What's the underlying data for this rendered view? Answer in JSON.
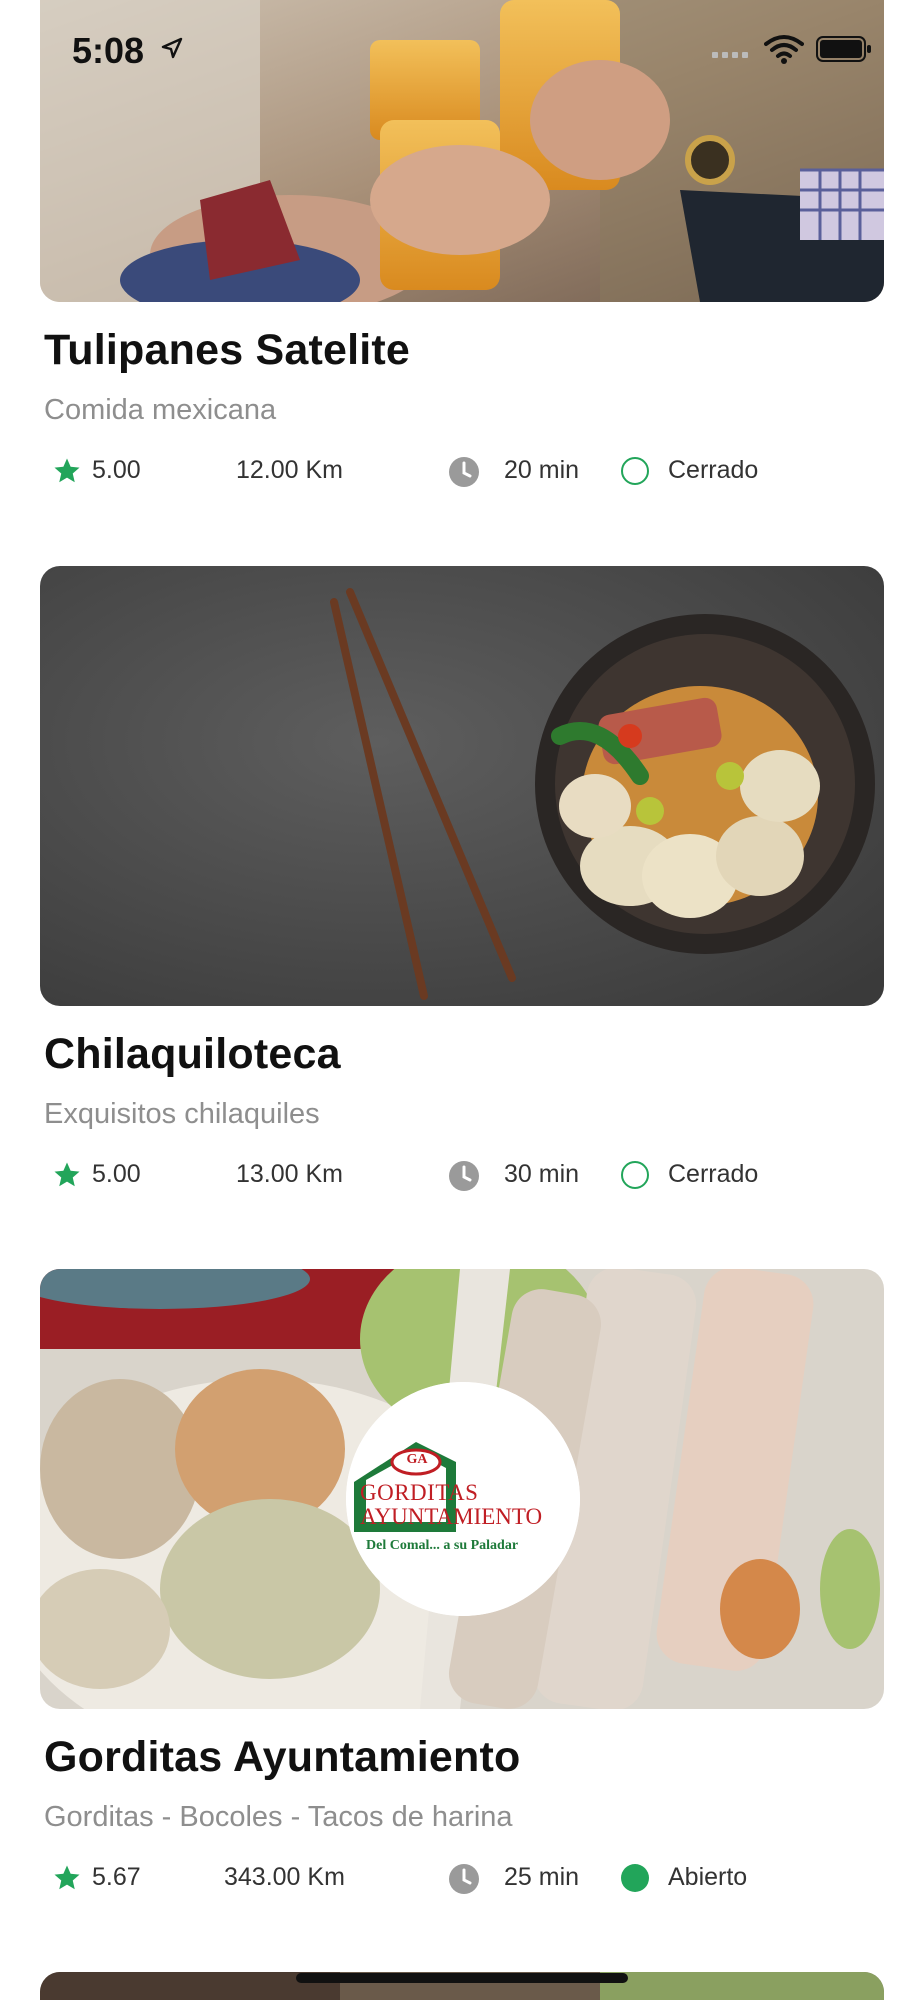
{
  "status_bar": {
    "time": "5:08"
  },
  "restaurants": [
    {
      "name": "Tulipanes Satelite",
      "subtitle": "Comida mexicana",
      "rating": "5.00",
      "distance": "12.00 Km",
      "time": "20 min",
      "status": "Cerrado",
      "status_open": false,
      "image_icon": "beer-toast-photo"
    },
    {
      "name": "Chilaquiloteca",
      "subtitle": "Exquisitos chilaquiles",
      "rating": "5.00",
      "distance": "13.00 Km",
      "time": "30 min",
      "status": "Cerrado",
      "status_open": false,
      "image_icon": "noodle-bowl-photo"
    },
    {
      "name": "Gorditas Ayuntamiento",
      "subtitle": "Gorditas - Bocoles - Tacos de harina",
      "rating": "5.67",
      "distance": "343.00 Km",
      "time": "25 min",
      "status": "Abierto",
      "status_open": true,
      "image_icon": "gorditas-photo",
      "logo": {
        "initials": "GA",
        "line1": "GORDITAS",
        "line2": "AYUNTAMIENTO",
        "tagline": "Del Comal... a su Paladar"
      }
    }
  ],
  "colors": {
    "accent_green": "#22a55a",
    "muted_gray": "#8e8e8e",
    "clock_gray": "#9a9a9a"
  }
}
